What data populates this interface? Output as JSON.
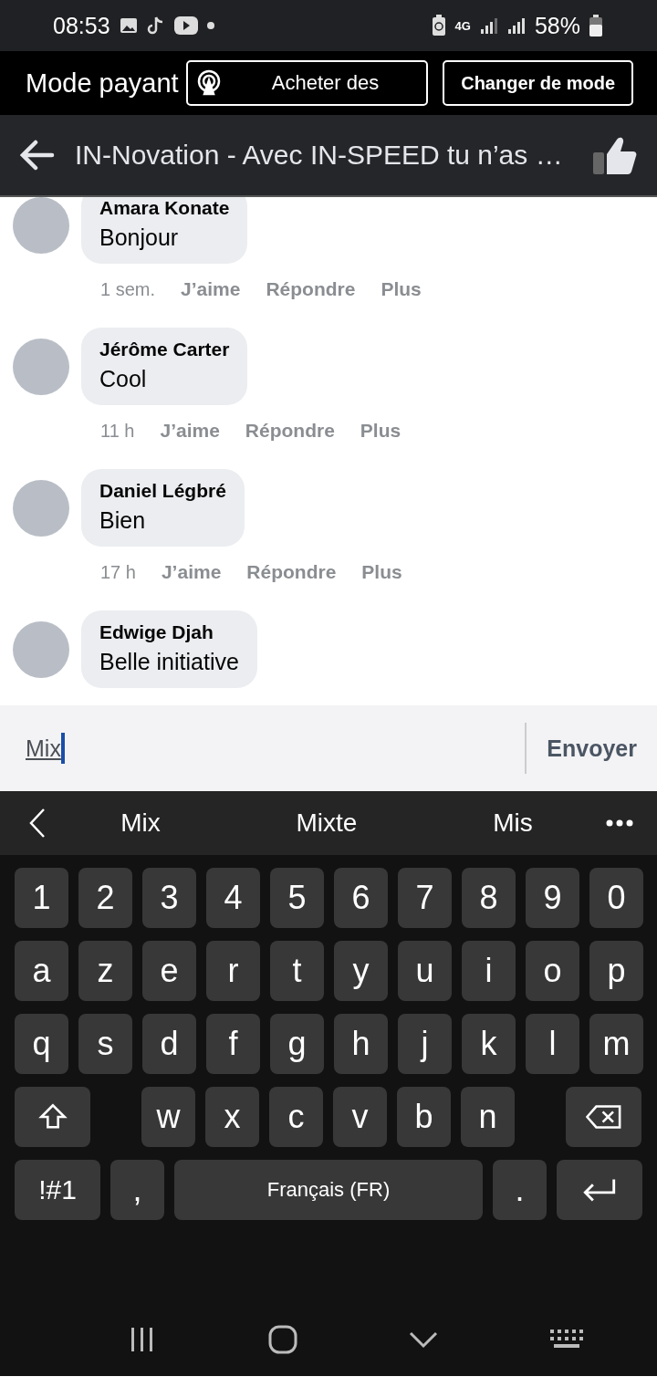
{
  "status_bar": {
    "time": "08:53",
    "network": "4G",
    "battery": "58%"
  },
  "paid_bar": {
    "label": "Mode payant",
    "buy_button": "Acheter des",
    "mode_button": "Changer de mode"
  },
  "header": {
    "title": "IN-Novation - Avec IN-SPEED tu n’as …"
  },
  "comments": [
    {
      "author": "Amara Konate",
      "text": "Bonjour",
      "time": "1 sem.",
      "actions": [
        "J’aime",
        "Répondre",
        "Plus"
      ]
    },
    {
      "author": "Jérôme Carter",
      "text": "Cool",
      "time": "11 h",
      "actions": [
        "J’aime",
        "Répondre",
        "Plus"
      ]
    },
    {
      "author": "Daniel Légbré",
      "text": "Bien",
      "time": "17 h",
      "actions": [
        "J’aime",
        "Répondre",
        "Plus"
      ]
    },
    {
      "author": "Edwige Djah",
      "text": "Belle initiative"
    }
  ],
  "composer": {
    "value": "Mix",
    "send": "Envoyer"
  },
  "suggestions": [
    "Mix",
    "Mixte",
    "Mis"
  ],
  "keyboard": {
    "rows": [
      [
        {
          "kind": "char",
          "label": "1"
        },
        {
          "kind": "char",
          "label": "2"
        },
        {
          "kind": "char",
          "label": "3"
        },
        {
          "kind": "char",
          "label": "4"
        },
        {
          "kind": "char",
          "label": "5"
        },
        {
          "kind": "char",
          "label": "6"
        },
        {
          "kind": "char",
          "label": "7"
        },
        {
          "kind": "char",
          "label": "8"
        },
        {
          "kind": "char",
          "label": "9"
        },
        {
          "kind": "char",
          "label": "0"
        }
      ],
      [
        {
          "kind": "char",
          "label": "a"
        },
        {
          "kind": "char",
          "label": "z"
        },
        {
          "kind": "char",
          "label": "e"
        },
        {
          "kind": "char",
          "label": "r"
        },
        {
          "kind": "char",
          "label": "t"
        },
        {
          "kind": "char",
          "label": "y"
        },
        {
          "kind": "char",
          "label": "u"
        },
        {
          "kind": "char",
          "label": "i"
        },
        {
          "kind": "char",
          "label": "o"
        },
        {
          "kind": "char",
          "label": "p"
        }
      ],
      [
        {
          "kind": "char",
          "label": "q"
        },
        {
          "kind": "char",
          "label": "s"
        },
        {
          "kind": "char",
          "label": "d"
        },
        {
          "kind": "char",
          "label": "f"
        },
        {
          "kind": "char",
          "label": "g"
        },
        {
          "kind": "char",
          "label": "h"
        },
        {
          "kind": "char",
          "label": "j"
        },
        {
          "kind": "char",
          "label": "k"
        },
        {
          "kind": "char",
          "label": "l"
        },
        {
          "kind": "char",
          "label": "m"
        }
      ],
      [
        {
          "kind": "shift"
        },
        "",
        {
          "kind": "char",
          "label": "w"
        },
        {
          "kind": "char",
          "label": "x"
        },
        {
          "kind": "char",
          "label": "c"
        },
        {
          "kind": "char",
          "label": "v"
        },
        {
          "kind": "char",
          "label": "b"
        },
        {
          "kind": "char",
          "label": "n"
        },
        {
          "kind": "backspace"
        }
      ]
    ],
    "bottom_row": {
      "symbols_key": "!#1",
      "comma_key": ",",
      "space_bar": "Français (FR)",
      "period_key": "."
    }
  }
}
